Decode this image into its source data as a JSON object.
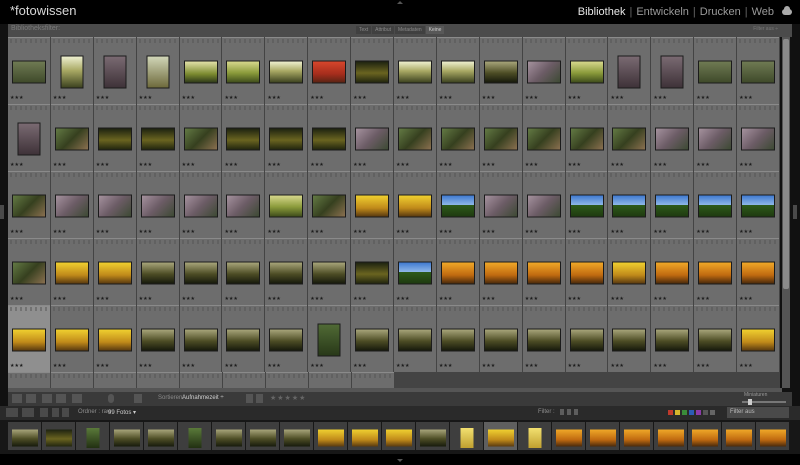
{
  "app": {
    "catalog_title": "*fotowissen",
    "modules": [
      {
        "label": "Bibliothek",
        "active": true
      },
      {
        "label": "Entwickeln",
        "active": false
      },
      {
        "label": "Drucken",
        "active": false
      },
      {
        "label": "Web",
        "active": false
      }
    ],
    "cloud_icon": "cloud-sync-icon"
  },
  "filter_bar": {
    "title": "Bibliotheksfilter:",
    "tabs": [
      {
        "label": "Text",
        "active": false
      },
      {
        "label": "Attribut",
        "active": false
      },
      {
        "label": "Metadaten",
        "active": false
      },
      {
        "label": "Keine",
        "active": true
      }
    ],
    "preset": "Filter aus ÷"
  },
  "grid": {
    "rows": [
      [
        "a",
        "c",
        "P",
        "k",
        "f",
        "b",
        "c",
        "r",
        "d",
        "c",
        "c",
        "n",
        "m",
        "b",
        "P",
        "P",
        "a",
        "a"
      ],
      [
        "P",
        "g",
        "d",
        "d",
        "g",
        "d",
        "d",
        "d",
        "m",
        "g",
        "g",
        "g",
        "g",
        "g",
        "g",
        "m",
        "m",
        "m"
      ],
      [
        "g",
        "m",
        "m",
        "m",
        "m",
        "m",
        "b",
        "g",
        "y",
        "y",
        "s",
        "m",
        "m",
        "s",
        "s",
        "s",
        "s",
        "s"
      ],
      [
        "g",
        "y",
        "y",
        "n",
        "n",
        "n",
        "n",
        "n",
        "d",
        "s",
        "o",
        "o",
        "o",
        "o",
        "y",
        "o",
        "o",
        "o"
      ],
      [
        "y",
        "y",
        "y",
        "n",
        "n",
        "n",
        "n",
        "p",
        "n",
        "n",
        "n",
        "n",
        "n",
        "n",
        "n",
        "n",
        "n",
        "y"
      ],
      [
        "x",
        "x",
        "x",
        "x",
        "x",
        "x",
        "x",
        "x",
        "x"
      ]
    ],
    "selected_cell": "4-0",
    "star_text": "★★★"
  },
  "toolbar": {
    "sort_label": "Sortieren:",
    "sort_value": "Aufnahmezeit ÷",
    "stars": "★★★★★",
    "thumbnails_label": "Miniaturen"
  },
  "filmstrip_bar": {
    "source": "Ordner : raw",
    "count": "99 Fotos ▾",
    "filter_label": "Filter :",
    "filter_value": "Filter aus",
    "swatches": [
      "#c0392b",
      "#d4b52c",
      "#3a8c3a",
      "#2c5cb5",
      "#8b3aa8",
      "#555555",
      "#666666"
    ]
  },
  "filmstrip": {
    "items": [
      "n",
      "d",
      "G",
      "n",
      "n",
      "G",
      "n",
      "n",
      "n",
      "y",
      "y",
      "y",
      "n",
      "Y",
      "y",
      "Y",
      "o",
      "o",
      "o",
      "o",
      "o",
      "o",
      "o"
    ],
    "selected_index": 14
  },
  "styles": {
    "accent": "#d2d2d2",
    "grid_bg": "#444444",
    "cell_bg": "#6d6d6d"
  }
}
